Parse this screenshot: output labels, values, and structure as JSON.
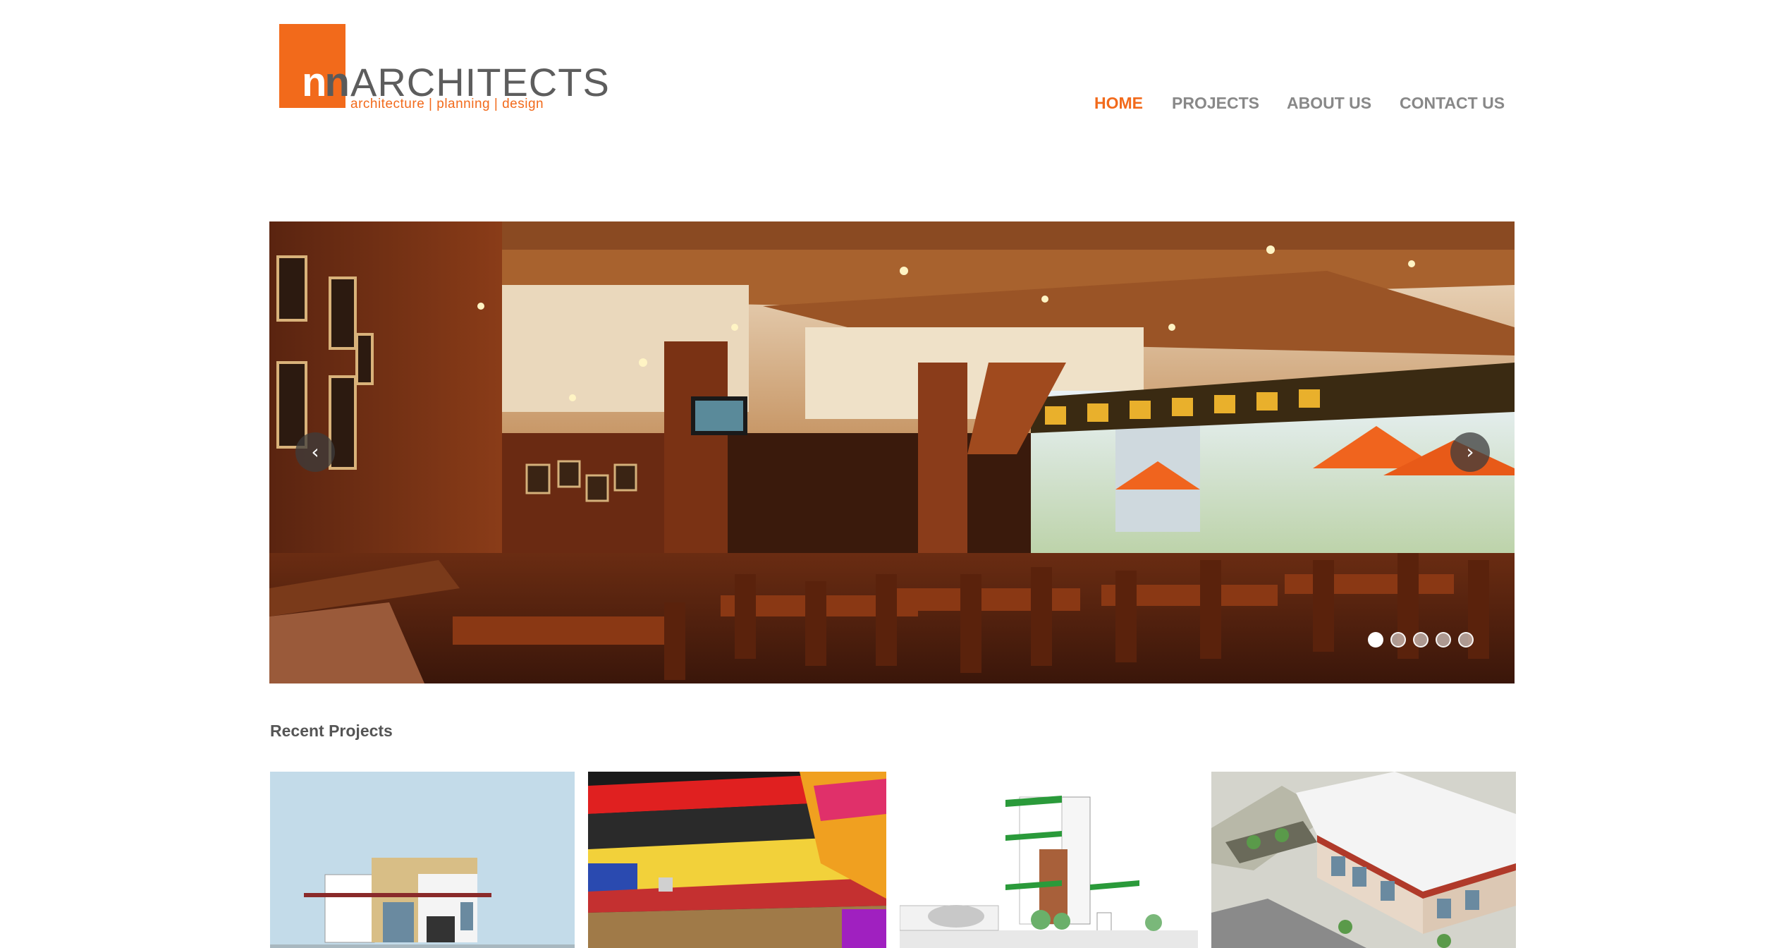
{
  "brand": {
    "logo_mark": "nn",
    "logo_word": "ARCHITECTS",
    "tagline": "architecture | planning | design",
    "accent_color": "#f26a1b"
  },
  "nav": {
    "items": [
      {
        "label": "HOME",
        "active": true
      },
      {
        "label": "PROJECTS",
        "active": false
      },
      {
        "label": "ABOUT US",
        "active": false
      },
      {
        "label": "CONTACT US",
        "active": false
      }
    ]
  },
  "slider": {
    "prev_icon": "chevron-left-icon",
    "next_icon": "chevron-right-icon",
    "slide_count": 5,
    "active_slide": 1
  },
  "recent_projects": {
    "title": "Recent Projects"
  }
}
